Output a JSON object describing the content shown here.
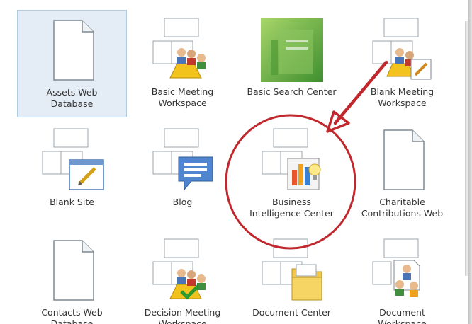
{
  "colors": {
    "selected_bg": "#e4edf6",
    "selected_border": "#aecbe4",
    "label_text": "#333333",
    "annotation": "#c0282d"
  },
  "templates": [
    {
      "label": "Assets Web\nDatabase",
      "icon": "document-icon",
      "selected": true
    },
    {
      "label": "Basic Meeting\nWorkspace",
      "icon": "meeting-workspace-icon",
      "selected": false
    },
    {
      "label": "Basic Search Center",
      "icon": "search-center-icon",
      "selected": false
    },
    {
      "label": "Blank Meeting\nWorkspace",
      "icon": "blank-meeting-workspace-icon",
      "selected": false
    },
    {
      "label": "Blank Site",
      "icon": "blank-site-icon",
      "selected": false
    },
    {
      "label": "Blog",
      "icon": "blog-icon",
      "selected": false
    },
    {
      "label": "Business\nIntelligence Center",
      "icon": "business-intelligence-icon",
      "selected": false
    },
    {
      "label": "Charitable\nContributions Web",
      "icon": "document-icon",
      "selected": false
    },
    {
      "label": "Contacts Web\nDatabase",
      "icon": "document-icon",
      "selected": false
    },
    {
      "label": "Decision Meeting\nWorkspace",
      "icon": "decision-workspace-icon",
      "selected": false
    },
    {
      "label": "Document Center",
      "icon": "document-center-icon",
      "selected": false
    },
    {
      "label": "Document\nWorkspace",
      "icon": "document-workspace-icon",
      "selected": false
    }
  ]
}
